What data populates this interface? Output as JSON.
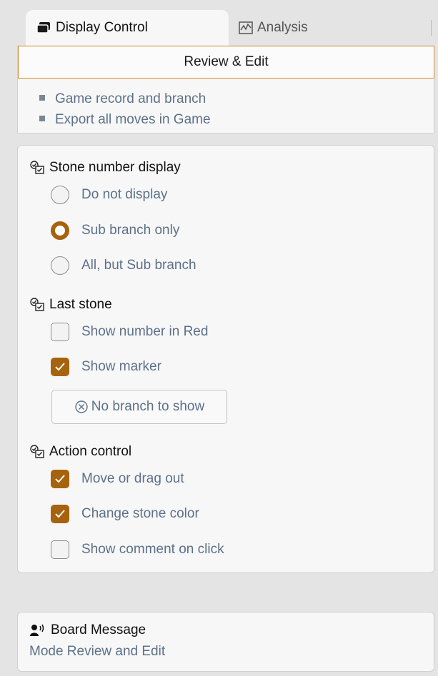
{
  "tabs": [
    {
      "label": "Display Control",
      "icon": "stones-icon",
      "active": true
    },
    {
      "label": "Analysis",
      "icon": "chart-icon",
      "active": false
    }
  ],
  "review_button": "Review & Edit",
  "links": [
    "Game record and branch",
    "Export all moves in Game"
  ],
  "stone_number": {
    "title": "Stone number display",
    "options": [
      {
        "label": "Do not display",
        "selected": false
      },
      {
        "label": "Sub branch only",
        "selected": true
      },
      {
        "label": "All, but Sub branch",
        "selected": false
      }
    ]
  },
  "last_stone": {
    "title": "Last stone",
    "options": [
      {
        "label": "Show number in Red",
        "checked": false
      },
      {
        "label": "Show marker",
        "checked": true
      }
    ],
    "button": "No branch to show"
  },
  "action_control": {
    "title": "Action control",
    "options": [
      {
        "label": "Move or drag out",
        "checked": true
      },
      {
        "label": "Change stone color",
        "checked": true
      },
      {
        "label": "Show comment on click",
        "checked": false
      }
    ]
  },
  "board_message": {
    "title": "Board Message",
    "text": "Mode Review and Edit"
  },
  "colors": {
    "accent": "#a7620d",
    "link": "#5c7189",
    "review_border": "#d08a2c"
  }
}
